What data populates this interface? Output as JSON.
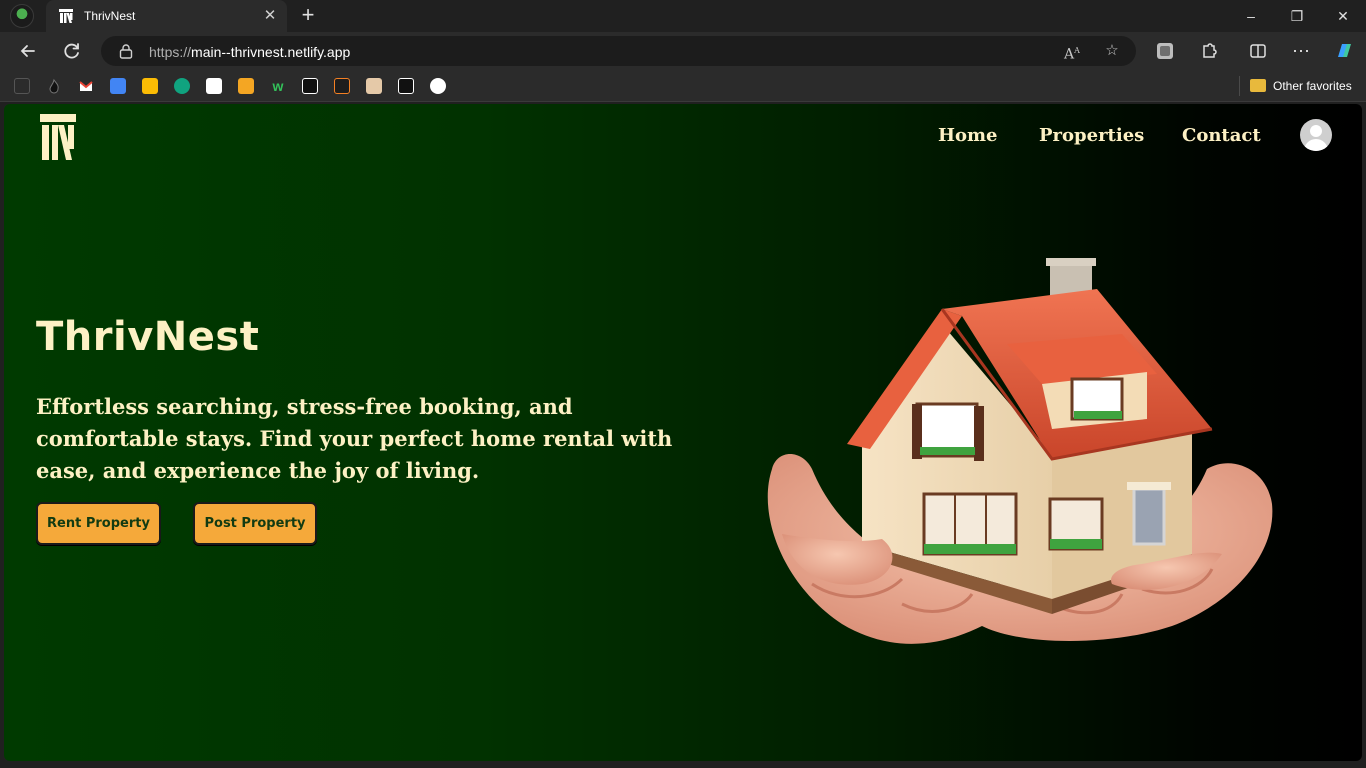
{
  "browser": {
    "tab_title": "ThrivNest",
    "tab_close": "✕",
    "new_tab": "+",
    "url_scheme": "https://",
    "url_host": "main--thrivnest.netlify.app",
    "other_favorites": "Other favorites",
    "window_controls": {
      "minimize": "–",
      "restore": "❐",
      "close": "✕"
    }
  },
  "page": {
    "nav": {
      "home": "Home",
      "properties": "Properties",
      "contact": "Contact"
    },
    "hero": {
      "title": "ThrivNest",
      "subtitle": "Effortless searching, stress-free booking, and comfortable stays. Find your perfect home rental with ease, and experience the joy of living.",
      "rent_button": "Rent Property",
      "post_button": "Post Property"
    }
  },
  "colors": {
    "accent": "#f5a93a",
    "text": "#fdf1c4",
    "background_start": "#003a00",
    "background_end": "#000000"
  }
}
